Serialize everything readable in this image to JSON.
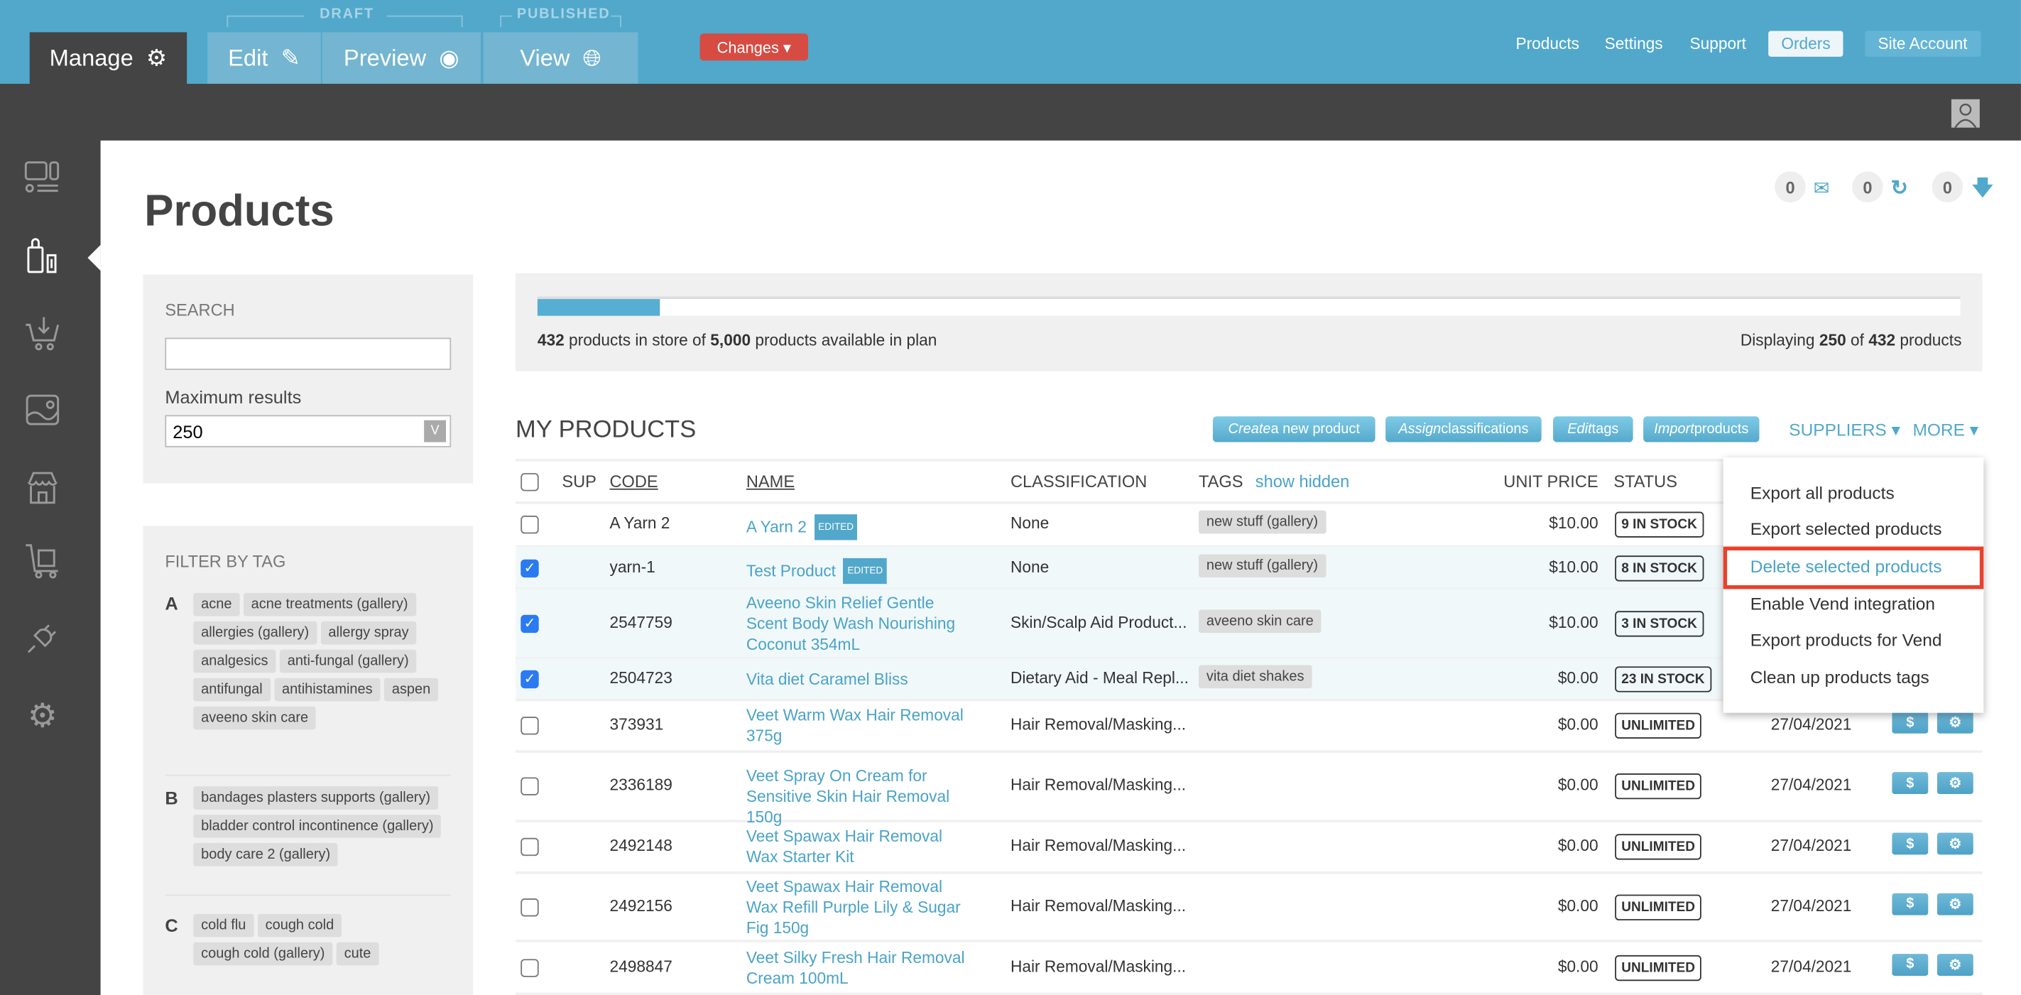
{
  "topbar": {
    "manage": "Manage",
    "draft_label": "DRAFT",
    "published_label": "PUBLISHED",
    "edit": "Edit",
    "preview": "Preview",
    "view": "View",
    "changes": "Changes ▾",
    "nav": [
      "Products",
      "Settings",
      "Support"
    ],
    "orders": "Orders",
    "site_account": "Site Account"
  },
  "colors": {
    "brand": "#51A8CB",
    "dark": "#444444",
    "danger": "#D64B42",
    "highlight": "#E8412C"
  },
  "sidebar": {
    "icons": [
      "layout-icon",
      "products-icon",
      "cart-download-icon",
      "image-icon",
      "store-icon",
      "shipping-cart-icon",
      "plugin-icon",
      "settings-icon"
    ],
    "active": "products-icon"
  },
  "page": {
    "title": "Products"
  },
  "counters": [
    {
      "value": "0",
      "icon": "mail-icon"
    },
    {
      "value": "0",
      "icon": "refresh-icon"
    },
    {
      "value": "0",
      "icon": "download-icon"
    }
  ],
  "search": {
    "label": "SEARCH",
    "value": "",
    "max_label": "Maximum results",
    "max_value": "250"
  },
  "filter": {
    "title": "FILTER BY TAG",
    "groups": [
      {
        "letter": "A",
        "tags": [
          "acne",
          "acne treatments (gallery)",
          "allergies (gallery)",
          "allergy spray",
          "analgesics",
          "anti-fungal (gallery)",
          "antifungal",
          "antihistamines",
          "aspen",
          "aveeno skin care"
        ]
      },
      {
        "letter": "B",
        "tags": [
          "bandages plasters supports (gallery)",
          "bladder control incontinence (gallery)",
          "body care 2 (gallery)"
        ]
      },
      {
        "letter": "C",
        "tags": [
          "cold flu",
          "cough cold",
          "cough cold (gallery)",
          "cute"
        ]
      }
    ]
  },
  "stats": {
    "in_store": "432",
    "plan": "5,000",
    "text1": " products in store of ",
    "text2": " products available in plan",
    "displaying": "Displaying ",
    "shown": "250",
    "of": " of ",
    "total": "432",
    "products": " products",
    "progress_percent": 8.64
  },
  "products": {
    "title": "MY PRODUCTS",
    "buttons": [
      {
        "em": "Create",
        "rest": " a new product"
      },
      {
        "em": "Assign",
        "rest": " classifications"
      },
      {
        "em": "Edit",
        "rest": " tags"
      },
      {
        "em": "Import",
        "rest": " products"
      }
    ],
    "suppliers": "SUPPLIERS ▾",
    "more": "MORE ▾",
    "headers": {
      "sup": "SUP",
      "code": "CODE",
      "name": "NAME",
      "classification": "CLASSIFICATION",
      "tags": "TAGS",
      "show_hidden": "show hidden",
      "unit_price": "UNIT PRICE",
      "status": "STATUS"
    },
    "edited_badge": "EDITED",
    "rows": [
      {
        "checked": false,
        "code": "A Yarn 2",
        "name": "A Yarn 2",
        "edited": true,
        "classification": "None",
        "tag": "new stuff (gallery)",
        "price": "$10.00",
        "status": "9 IN STOCK",
        "date": ""
      },
      {
        "checked": true,
        "code": "yarn-1",
        "name": "Test Product",
        "edited": true,
        "classification": "None",
        "tag": "new stuff (gallery)",
        "price": "$10.00",
        "status": "8 IN STOCK",
        "date": ""
      },
      {
        "checked": true,
        "code": "2547759",
        "name": "Aveeno Skin Relief Gentle Scent Body Wash Nourishing Coconut 354mL",
        "edited": false,
        "classification": "Skin/Scalp Aid Product...",
        "tag": "aveeno skin care",
        "price": "$10.00",
        "status": "3 IN STOCK",
        "date": ""
      },
      {
        "checked": true,
        "code": "2504723",
        "name": "Vita diet Caramel Bliss",
        "edited": false,
        "classification": "Dietary Aid - Meal Repl...",
        "tag": "vita diet shakes",
        "price": "$0.00",
        "status": "23 IN STOCK",
        "date": ""
      },
      {
        "checked": false,
        "code": "373931",
        "name": "Veet Warm Wax Hair Removal 375g",
        "edited": false,
        "classification": "Hair Removal/Masking...",
        "tag": "",
        "price": "$0.00",
        "status": "UNLIMITED",
        "date": "27/04/2021"
      },
      {
        "checked": false,
        "code": "2336189",
        "name": "Veet Spray On Cream for Sensitive Skin Hair Removal 150g",
        "edited": false,
        "classification": "Hair Removal/Masking...",
        "tag": "",
        "price": "$0.00",
        "status": "UNLIMITED",
        "date": "27/04/2021"
      },
      {
        "checked": false,
        "code": "2492148",
        "name": "Veet Spawax Hair Removal Wax Starter Kit",
        "edited": false,
        "classification": "Hair Removal/Masking...",
        "tag": "",
        "price": "$0.00",
        "status": "UNLIMITED",
        "date": "27/04/2021"
      },
      {
        "checked": false,
        "code": "2492156",
        "name": "Veet Spawax Hair Removal Wax Refill Purple Lily & Sugar Fig 150g",
        "edited": false,
        "classification": "Hair Removal/Masking...",
        "tag": "",
        "price": "$0.00",
        "status": "UNLIMITED",
        "date": "27/04/2021"
      },
      {
        "checked": false,
        "code": "2498847",
        "name": "Veet Silky Fresh Hair Removal Cream 100mL",
        "edited": false,
        "classification": "Hair Removal/Masking...",
        "tag": "",
        "price": "$0.00",
        "status": "UNLIMITED",
        "date": "27/04/2021"
      }
    ]
  },
  "more_menu": {
    "items": [
      "Export all products",
      "Export selected products",
      "Delete selected products",
      "Enable Vend integration",
      "Export products for Vend",
      "Clean up products tags"
    ],
    "highlighted": "Delete selected products"
  }
}
